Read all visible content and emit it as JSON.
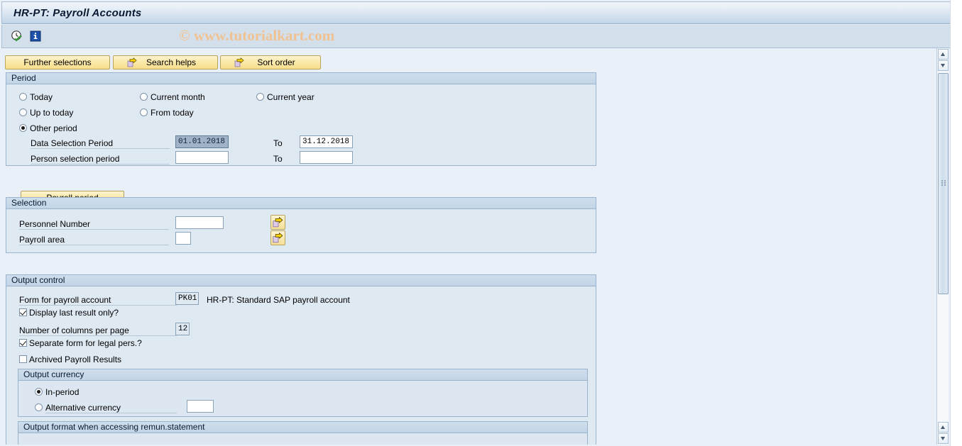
{
  "window": {
    "title": "HR-PT: Payroll Accounts"
  },
  "watermark": {
    "text": "© www.tutorialkart.com"
  },
  "toolbar": {
    "execute_icon": "clock-check-icon",
    "info_icon": "information-icon"
  },
  "actions": {
    "further_selections": "Further selections",
    "search_helps": "Search helps",
    "sort_order": "Sort order"
  },
  "period": {
    "legend": "Period",
    "options": [
      {
        "label": "Today",
        "selected": false
      },
      {
        "label": "Current month",
        "selected": false
      },
      {
        "label": "Current year",
        "selected": false
      },
      {
        "label": "Up to today",
        "selected": false
      },
      {
        "label": "From today",
        "selected": false
      },
      {
        "label": "Other period",
        "selected": true
      }
    ],
    "data_selection_period_label": "Data Selection Period",
    "data_selection_period_from": "01.01.2018",
    "data_selection_period_to_label": "To",
    "data_selection_period_to": "31.12.2018",
    "person_selection_period_label": "Person selection period",
    "person_selection_period_from": "",
    "person_selection_period_to_label": "To",
    "person_selection_period_to": "",
    "payroll_period_button": "Payroll period"
  },
  "selection": {
    "legend": "Selection",
    "personnel_number_label": "Personnel Number",
    "personnel_number_value": "",
    "payroll_area_label": "Payroll area",
    "payroll_area_value": "",
    "multi_select_icon": "multiple-selection-arrow-icon"
  },
  "output_control": {
    "legend": "Output control",
    "form_label": "Form for payroll account",
    "form_value": "PK01",
    "form_description": "HR-PT: Standard SAP payroll account",
    "display_last_result_label": "Display last result only?",
    "display_last_result_checked": true,
    "columns_label": "Number of columns per page",
    "columns_value": "12",
    "separate_form_label": "Separate form for legal pers.?",
    "separate_form_checked": true,
    "archived_results_label": "Archived Payroll Results",
    "archived_results_checked": false,
    "output_currency": {
      "legend": "Output currency",
      "in_period_label": "In-period",
      "in_period_selected": true,
      "alternative_label": "Alternative currency",
      "alternative_selected": false,
      "alternative_value": ""
    },
    "output_format": {
      "legend": "Output format when accessing remun.statement"
    }
  },
  "colors": {
    "accent_button": "#f7dd8c",
    "panel_bg": "#dfe9f2",
    "page_bg": "#eaf0f8",
    "watermark": "#f0c292"
  }
}
